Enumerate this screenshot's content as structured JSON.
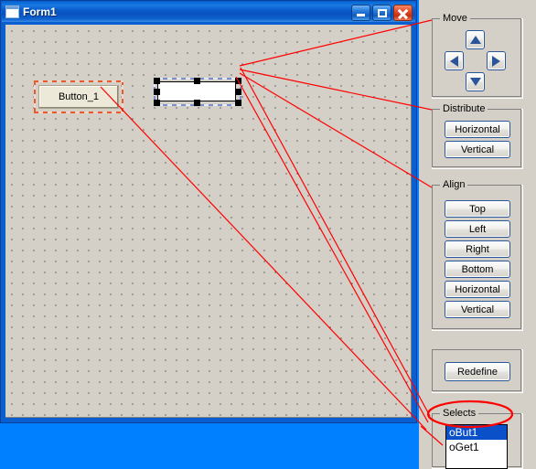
{
  "window": {
    "title": "Form1",
    "icon": "form-window-icon",
    "buttons": {
      "minimize": "minimize-button",
      "maximize": "maximize-button",
      "close": "close-button"
    }
  },
  "form_controls": [
    {
      "name": "Button_1",
      "type": "button",
      "selected": true
    },
    {
      "name": "",
      "type": "textbox",
      "selected": true
    }
  ],
  "panel": {
    "move": {
      "label": "Move",
      "buttons": [
        {
          "name": "move-up",
          "icon": "arrow-up-icon"
        },
        {
          "name": "move-left",
          "icon": "arrow-left-icon"
        },
        {
          "name": "move-right",
          "icon": "arrow-right-icon"
        },
        {
          "name": "move-down",
          "icon": "arrow-down-icon"
        }
      ]
    },
    "distribute": {
      "label": "Distribute",
      "buttons": [
        "Horizontal",
        "Vertical"
      ]
    },
    "align": {
      "label": "Align",
      "buttons": [
        "Top",
        "Left",
        "Right",
        "Bottom",
        "Horizontal",
        "Vertical"
      ]
    },
    "redefine": {
      "label": "",
      "buttons": [
        "Redefine"
      ]
    },
    "selects": {
      "label": "Selects",
      "items": [
        {
          "label": "oBut1",
          "selected": true
        },
        {
          "label": "oGet1",
          "selected": false
        }
      ]
    }
  },
  "colors": {
    "desktop": "#0080ff",
    "panel_face": "#d4d0c8",
    "title_blue": "#0a5ccd",
    "annotation_red": "#ff0000",
    "selection_blue": "#0a50c8",
    "arrow_blue": "#2a5699"
  },
  "annotations": {
    "type": "red-callout-lines",
    "ellipse_target": "Selects",
    "count": 7
  }
}
